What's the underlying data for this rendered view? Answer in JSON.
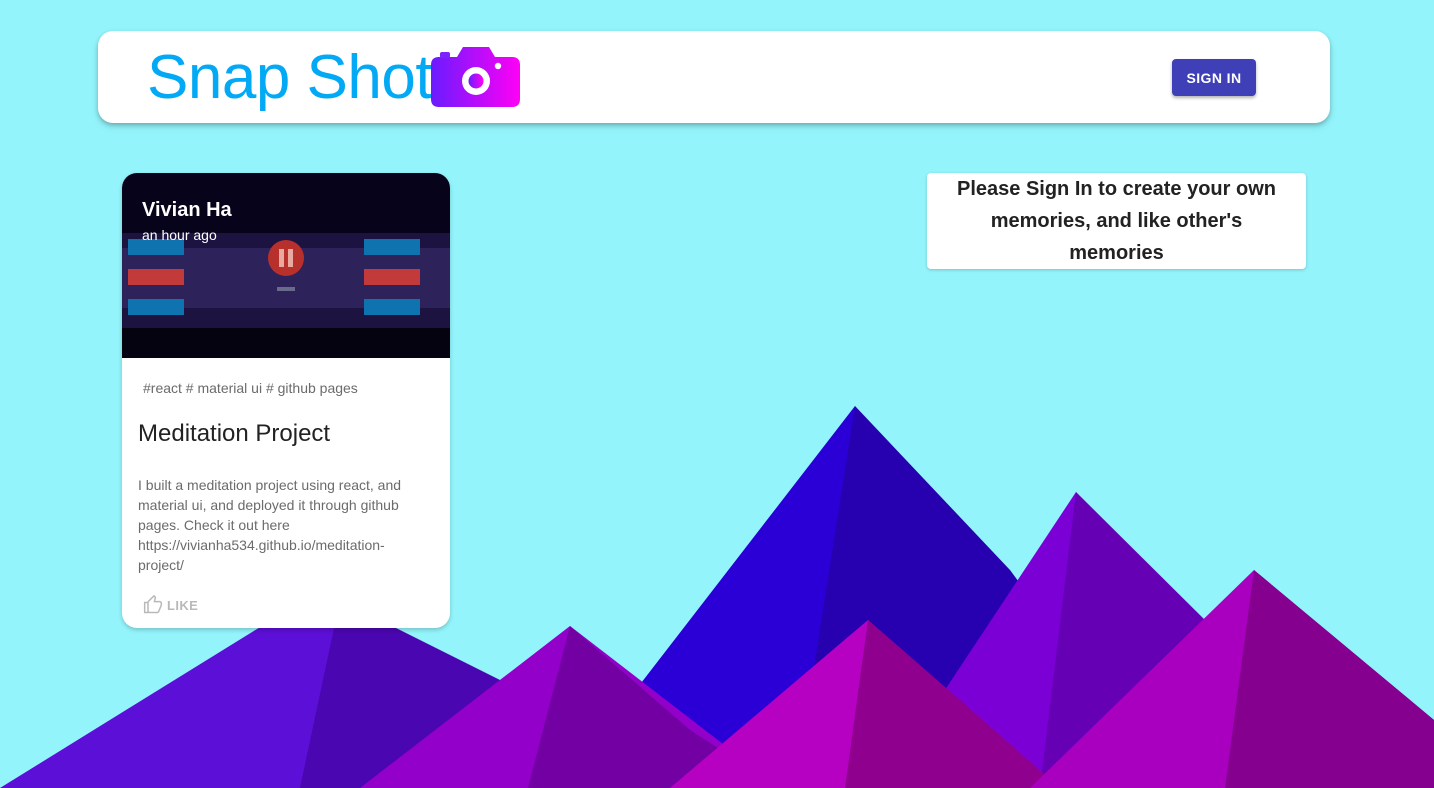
{
  "app": {
    "title": "Snap Shot",
    "logo_icon": "camera-icon",
    "accent_color": "#03a9f4",
    "background_color": "#93f4fb"
  },
  "header": {
    "signin_label": "SIGN IN",
    "signin_color": "#3f40b7"
  },
  "post": {
    "author": "Vivian Ha",
    "time": "an hour ago",
    "tags": "#react # material ui # github pages",
    "title": "Meditation Project",
    "description": "I built a meditation project using react, and material ui, and deployed it through github pages. Check it out here https://vivianha534.github.io/meditation-project/",
    "like_label": "LIKE",
    "like_icon": "thumb-up-icon"
  },
  "notice": {
    "text": "Please Sign In to create your own memories, and like other's memories"
  }
}
